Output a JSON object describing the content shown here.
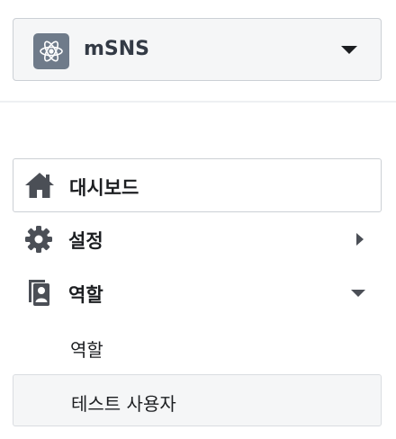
{
  "app_selector": {
    "name": "mSNS",
    "icon": "atom-icon"
  },
  "nav": {
    "dashboard": {
      "label": "대시보드",
      "icon": "home-icon"
    },
    "settings": {
      "label": "설정",
      "icon": "gear-icon"
    },
    "roles": {
      "label": "역할",
      "icon": "roles-icon",
      "children": [
        {
          "label": "역할"
        },
        {
          "label": "테스트 사용자"
        }
      ]
    }
  },
  "colors": {
    "icon_color": "#4b4f56",
    "active_bg": "#f5f6f7",
    "border": "#ccd0d5"
  }
}
